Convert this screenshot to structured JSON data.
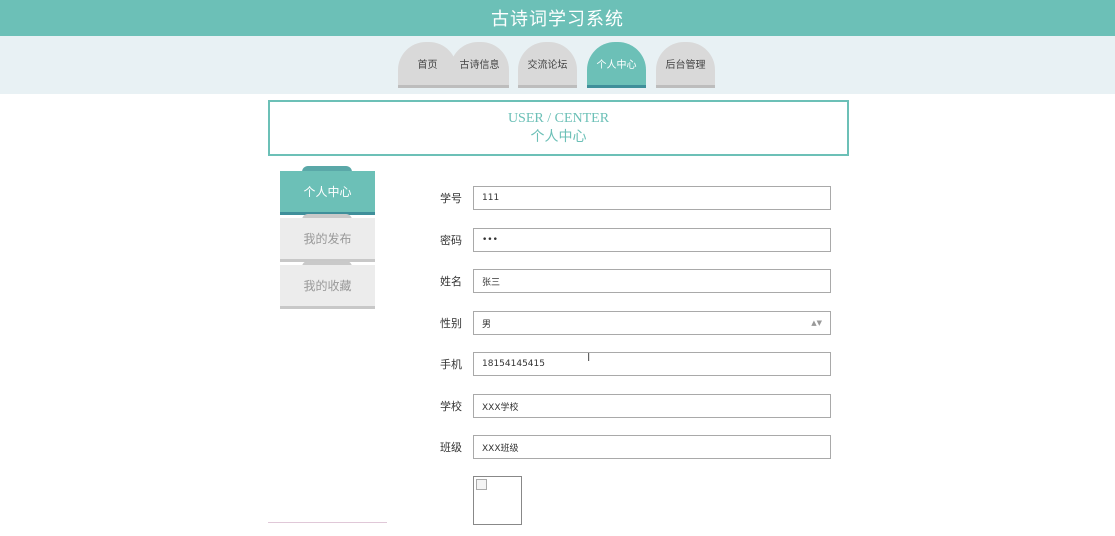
{
  "app": {
    "title": "古诗词学习系统"
  },
  "nav": {
    "tabs": [
      {
        "label": "首页",
        "active": false
      },
      {
        "label": "古诗信息",
        "active": false
      },
      {
        "label": "交流论坛",
        "active": false
      },
      {
        "label": "个人中心",
        "active": true
      },
      {
        "label": "后台管理",
        "active": false
      }
    ]
  },
  "banner": {
    "en": "USER / CENTER",
    "cn": "个人中心"
  },
  "sidebar": {
    "items": [
      {
        "label": "个人中心",
        "active": true
      },
      {
        "label": "我的发布",
        "active": false
      },
      {
        "label": "我的收藏",
        "active": false
      }
    ]
  },
  "form": {
    "fields": [
      {
        "label": "学号",
        "value": "111"
      },
      {
        "label": "密码",
        "value": "•••"
      },
      {
        "label": "姓名",
        "value": "张三"
      },
      {
        "label": "性别",
        "value": "男"
      },
      {
        "label": "手机",
        "value": "18154145415"
      },
      {
        "label": "学校",
        "value": "XXX学校"
      },
      {
        "label": "班级",
        "value": "XXX班级"
      }
    ]
  },
  "colors": {
    "accent": "#6cc0b7",
    "accent_dark": "#3f8f9a",
    "nav_band": "#e8f1f4"
  }
}
